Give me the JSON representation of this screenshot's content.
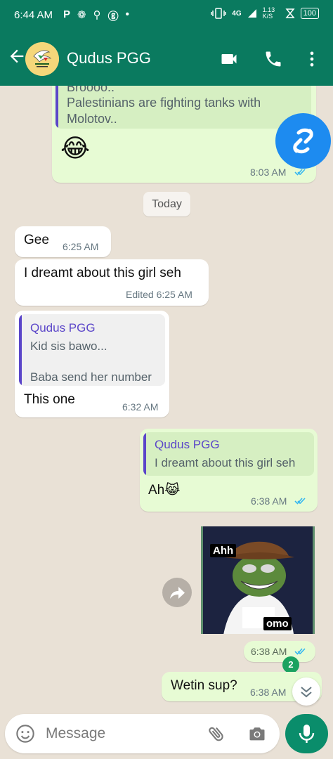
{
  "colors": {
    "header": "#0a7a5f",
    "outgoing": "#e7fbd4",
    "incoming": "#ffffff",
    "accent_name": "#5b46c9",
    "tick_blue": "#34b7f1"
  },
  "status_bar": {
    "time": "6:44 AM",
    "left_icons": [
      "P",
      "❁",
      "⚲",
      "ⓖ",
      "•"
    ],
    "network": "4G",
    "speed": "1.13 K/S",
    "battery": "100"
  },
  "header": {
    "contact_name": "Qudus PGG",
    "icons": [
      "back-arrow-icon",
      "video-call-icon",
      "voice-call-icon",
      "more-options-icon"
    ]
  },
  "messages": [
    {
      "id": "m0",
      "dir": "out",
      "quoted_lines": [
        "Broooo..",
        "Palestinians are fighting tanks with",
        "Molotov.."
      ],
      "emoji": "😂",
      "time": "8:03 AM",
      "status": "read"
    },
    {
      "id": "date",
      "label": "Today"
    },
    {
      "id": "m1",
      "dir": "in",
      "text": "Gee",
      "time": "6:25 AM"
    },
    {
      "id": "m2",
      "dir": "in",
      "text": "I dreamt about this girl seh",
      "time": "Edited 6:25 AM"
    },
    {
      "id": "m3",
      "dir": "in",
      "quote_name": "Qudus PGG",
      "quote_lines": [
        "Kid sis bawo...",
        "",
        "Baba send her number"
      ],
      "text": "This one",
      "time": "6:32 AM"
    },
    {
      "id": "m4",
      "dir": "out",
      "quote_name": "Qudus PGG",
      "quote_lines": [
        "I dreamt about this girl seh"
      ],
      "text": "Ah😹",
      "time": "6:38 AM",
      "status": "read"
    },
    {
      "id": "m5",
      "dir": "out",
      "sticker_top_text": "Ahh",
      "sticker_bottom_text": "omo",
      "time": "6:38 AM",
      "status": "read"
    },
    {
      "id": "m6",
      "dir": "out",
      "text": "Wetin sup?",
      "time": "6:38 AM",
      "status": "read"
    }
  ],
  "unread_count": "2",
  "composer": {
    "placeholder": "Message"
  }
}
